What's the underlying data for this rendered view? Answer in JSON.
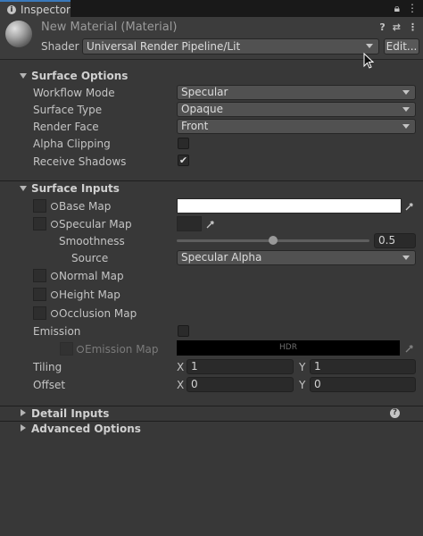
{
  "window": {
    "tab_label": "Inspector"
  },
  "header": {
    "material_name": "New Material (Material)",
    "shader_label": "Shader",
    "shader_value": "Universal Render Pipeline/Lit",
    "edit_button": "Edit..."
  },
  "surface_options": {
    "title": "Surface Options",
    "rows": [
      {
        "label": "Workflow Mode",
        "value": "Specular"
      },
      {
        "label": "Surface Type",
        "value": "Opaque"
      },
      {
        "label": "Render Face",
        "value": "Front"
      }
    ],
    "alpha_clipping": {
      "label": "Alpha Clipping",
      "checked": false
    },
    "receive_shadows": {
      "label": "Receive Shadows",
      "checked": true,
      "check_glyph": "✔"
    }
  },
  "surface_inputs": {
    "title": "Surface Inputs",
    "base_map": "Base Map",
    "specular_map": "Specular Map",
    "smoothness": {
      "label": "Smoothness",
      "value": "0.5",
      "fraction": 0.5
    },
    "source": {
      "label": "Source",
      "value": "Specular Alpha"
    },
    "normal_map": "Normal Map",
    "height_map": "Height Map",
    "occlusion_map": "Occlusion Map",
    "emission": {
      "label": "Emission",
      "map_label": "Emission Map",
      "hdr_text": "HDR"
    },
    "tiling": {
      "label": "Tiling",
      "x_label": "X",
      "x": "1",
      "y_label": "Y",
      "y": "1"
    },
    "offset": {
      "label": "Offset",
      "x_label": "X",
      "x": "0",
      "y_label": "Y",
      "y": "0"
    }
  },
  "detail_inputs": {
    "title": "Detail Inputs"
  },
  "advanced_options": {
    "title": "Advanced Options"
  },
  "colors": {
    "panel_bg": "#383838",
    "tab_accent": "#3a79bb",
    "base_map_color": "#ffffff"
  }
}
